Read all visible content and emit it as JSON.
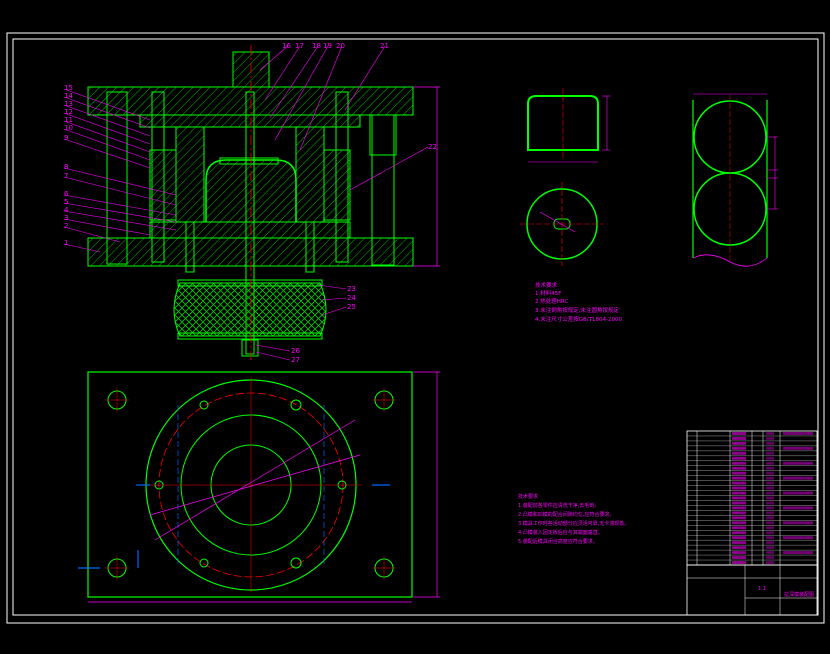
{
  "colors": {
    "background": "#000000",
    "frame": "#ffffff",
    "part": "#00ff00",
    "dim": "#ff00ff",
    "center": "#ff0000",
    "axis": "#0066ff",
    "hatch": "#00ff00"
  },
  "callouts_top": [
    "16",
    "17",
    "18",
    "19",
    "20",
    "21"
  ],
  "callouts_left": [
    "15",
    "14",
    "13",
    "12",
    "11",
    "10",
    "9",
    "8",
    "7",
    "6",
    "5",
    "4",
    "3",
    "2",
    "1"
  ],
  "callouts_right": [
    "22",
    "23",
    "24",
    "25",
    "26",
    "27"
  ],
  "notes_1": {
    "title": "技术要求",
    "lines": [
      "1.材料45F",
      "2.热处理HRC",
      "3.未注倒角按规定,未注圆角按规定",
      "4.未注尺寸公差按GB/T1804-2000"
    ]
  },
  "notes_2": {
    "title": "技术要求",
    "lines": [
      "1.装配前各零件应清洗干净,去毛刺。",
      "2.凸模和凹模的配合间隙均匀,应符合要求。",
      "3.模具工作时各活动部分应灵活可靠,无卡滞现象。",
      "4.凸模装入固定板后应与其端面垂直。",
      "5.装配后模具闭合高度应符合要求。"
    ]
  },
  "bom_rows": 27,
  "title_block": {
    "drawing_name": "拉深模装配图",
    "scale": "1:1"
  }
}
